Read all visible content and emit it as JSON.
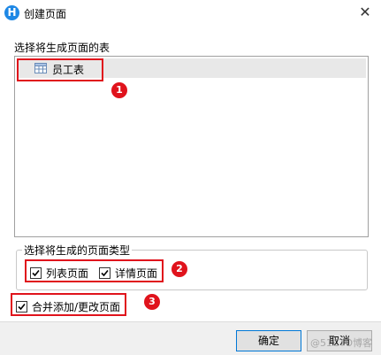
{
  "window": {
    "title": "创建页面",
    "app_icon_letter": "H",
    "close_glyph": "✕"
  },
  "table_section": {
    "label": "选择将生成页面的表",
    "tables": [
      {
        "name": "员工表"
      }
    ]
  },
  "page_type_group": {
    "legend": "选择将生成的页面类型",
    "options": [
      {
        "label": "列表页面",
        "checked": true
      },
      {
        "label": "详情页面",
        "checked": true
      }
    ]
  },
  "merge_option": {
    "label": "合并添加/更改页面",
    "checked": true
  },
  "annotations": {
    "badges": [
      "1",
      "2",
      "3"
    ],
    "highlight_color": "#e0131c"
  },
  "buttons": {
    "ok": "确定",
    "cancel": "取消"
  },
  "watermark": "@51CTO博客"
}
